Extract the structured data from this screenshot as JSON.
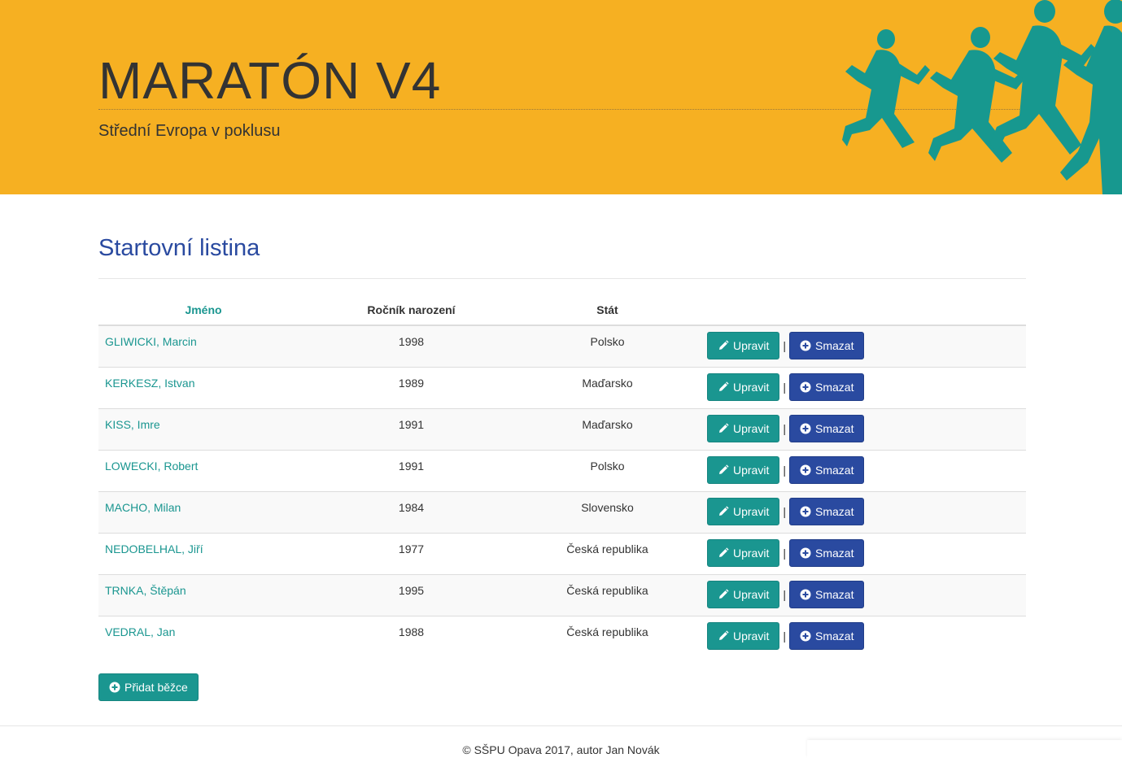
{
  "header": {
    "title": "MARATÓN V4",
    "subtitle": "Střední Evropa v poklusu"
  },
  "colors": {
    "banner": "#f6b022",
    "teal": "#1a9690",
    "blue": "#2a4aa0",
    "runner": "#17988f"
  },
  "main": {
    "title": "Startovní listina",
    "columns": {
      "name": "Jméno",
      "year": "Ročník narození",
      "country": "Stát"
    },
    "buttons": {
      "edit": "Upravit",
      "delete": "Smazat",
      "separator": "|"
    },
    "rows": [
      {
        "name": "GLIWICKI, Marcin",
        "year": "1998",
        "country": "Polsko"
      },
      {
        "name": "KERKESZ, Istvan",
        "year": "1989",
        "country": "Maďarsko"
      },
      {
        "name": "KISS, Imre",
        "year": "1991",
        "country": "Maďarsko"
      },
      {
        "name": "LOWECKI, Robert",
        "year": "1991",
        "country": "Polsko"
      },
      {
        "name": "MACHO, Milan",
        "year": "1984",
        "country": "Slovensko"
      },
      {
        "name": "NEDOBELHAL, Jiří",
        "year": "1977",
        "country": "Česká republika"
      },
      {
        "name": "TRNKA, Štěpán",
        "year": "1995",
        "country": "Česká republika"
      },
      {
        "name": "VEDRAL, Jan",
        "year": "1988",
        "country": "Česká republika"
      }
    ],
    "add_button": "Přidat běžce"
  },
  "footer": {
    "text": "© SŠPU Opava 2017, autor Jan Novák"
  },
  "icons": {
    "edit": "pencil-icon",
    "delete": "plus-circle-icon",
    "add": "plus-circle-icon",
    "banner": "runners-silhouette-icon"
  }
}
